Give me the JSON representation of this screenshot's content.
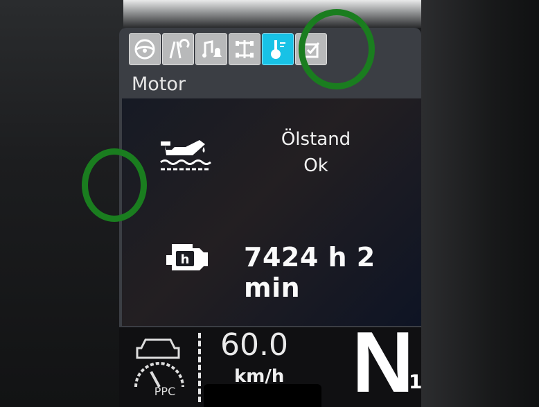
{
  "tabs": [
    {
      "icon": "steering-wheel-icon",
      "active": false
    },
    {
      "icon": "road-assist-icon",
      "active": false
    },
    {
      "icon": "music-bell-icon",
      "active": false
    },
    {
      "icon": "axle-icon",
      "active": false
    },
    {
      "icon": "oil-temperature-icon",
      "active": true
    },
    {
      "icon": "checklist-icon",
      "active": false
    }
  ],
  "section_title": "Motor",
  "oil": {
    "label": "Ölstand",
    "status": "Ok",
    "icon": "oil-can-icon"
  },
  "engine": {
    "hours": "7424 h 2 min",
    "icon": "engine-hours-icon"
  },
  "ppc": {
    "label": "PPC",
    "icon": "ppc-speed-icon"
  },
  "speed": {
    "value": "60.0",
    "unit": "km/h"
  },
  "gear": {
    "value": "N",
    "sub": "1"
  },
  "colors": {
    "accent": "#18c2e6",
    "highlight_circle": "#1a7d1f"
  }
}
